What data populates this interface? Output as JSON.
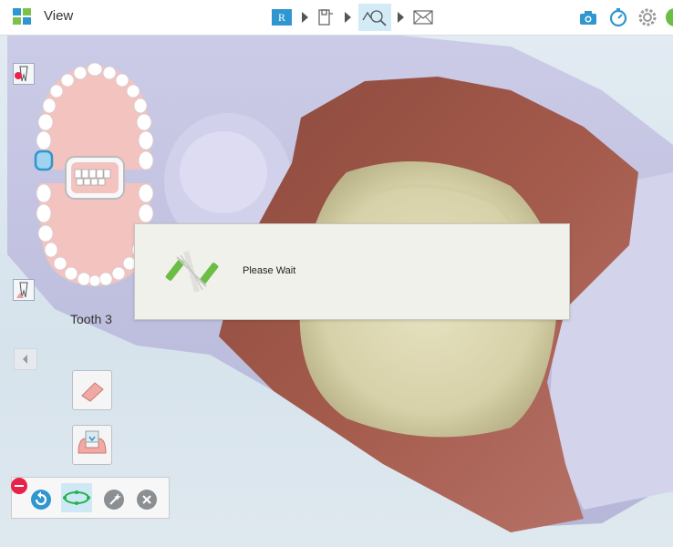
{
  "topbar": {
    "view_label": "View",
    "steps": [
      {
        "name": "rx",
        "label": "R",
        "active": false
      },
      {
        "name": "scan",
        "active": false
      },
      {
        "name": "view",
        "active": true
      },
      {
        "name": "send",
        "active": false
      }
    ],
    "right_icons": [
      "camera-icon",
      "timer-icon",
      "settings-icon",
      "help-icon"
    ]
  },
  "sidebar": {
    "tooth_label": "Tooth 3",
    "selected_tooth": 3
  },
  "dialog": {
    "message": "Please Wait"
  },
  "bottom_tools": [
    "rotate-icon",
    "margin-line-icon",
    "magic-wand-icon",
    "close-icon"
  ],
  "colors": {
    "accent": "#2f96cf",
    "gum": "#f3c3c0",
    "selection": "#3aa7e0",
    "margin_green": "#22b24c",
    "alert_red": "#e8234a"
  }
}
